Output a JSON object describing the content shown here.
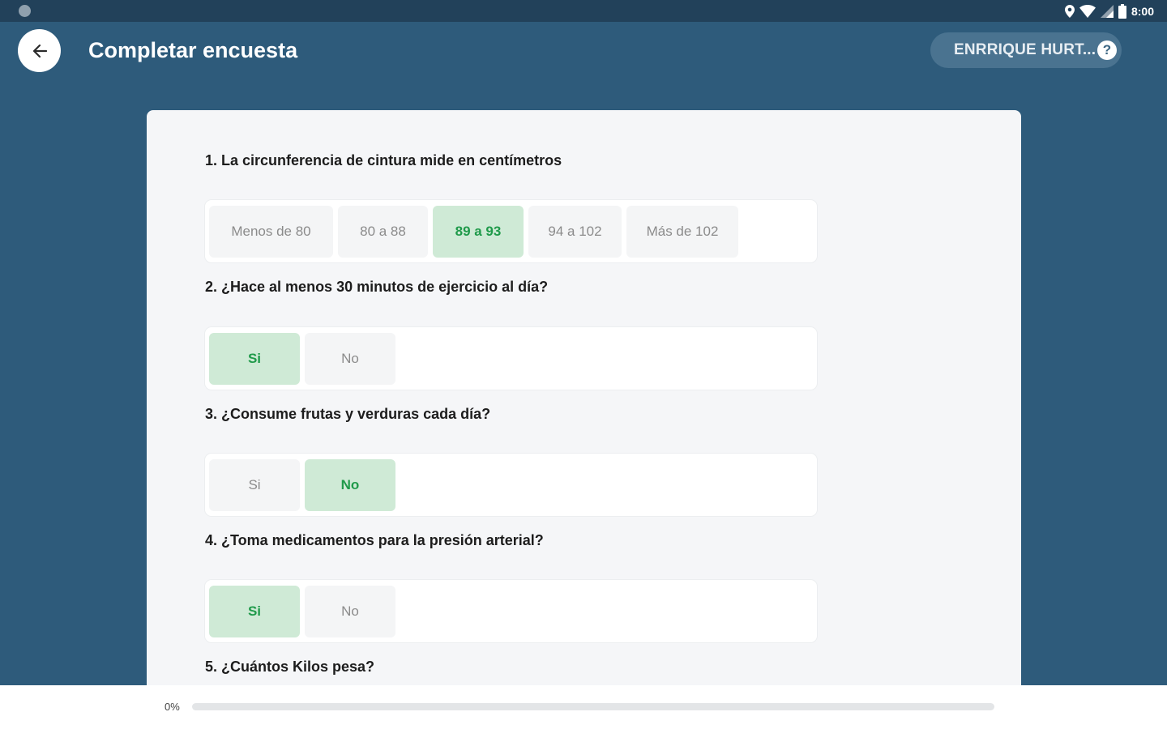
{
  "status_bar": {
    "time": "8:00"
  },
  "header": {
    "title": "Completar encuesta",
    "user_name": "ENRRIQUE HURT...",
    "help_label": "?"
  },
  "questions": [
    {
      "label": "1. La circunferencia de cintura mide en centímetros",
      "options": [
        "Menos de 80",
        "80 a 88",
        "89 a 93",
        "94 a 102",
        "Más de 102"
      ],
      "selected": "89 a 93"
    },
    {
      "label": "2. ¿Hace al menos 30 minutos de ejercicio al día?",
      "options": [
        "Si",
        "No"
      ],
      "selected": "Si"
    },
    {
      "label": "3. ¿Consume frutas y verduras cada día?",
      "options": [
        "Si",
        "No"
      ],
      "selected": "No"
    },
    {
      "label": "4. ¿Toma medicamentos para la presión arterial?",
      "options": [
        "Si",
        "No"
      ],
      "selected": "Si"
    },
    {
      "label": "5. ¿Cuántos Kilos pesa?"
    }
  ],
  "progress": {
    "label": "0%",
    "value": 0
  },
  "colors": {
    "background": "#2e5b7b",
    "status_bar": "#22415a",
    "selected_bg": "#cfead6",
    "selected_text": "#1f9a4a"
  }
}
